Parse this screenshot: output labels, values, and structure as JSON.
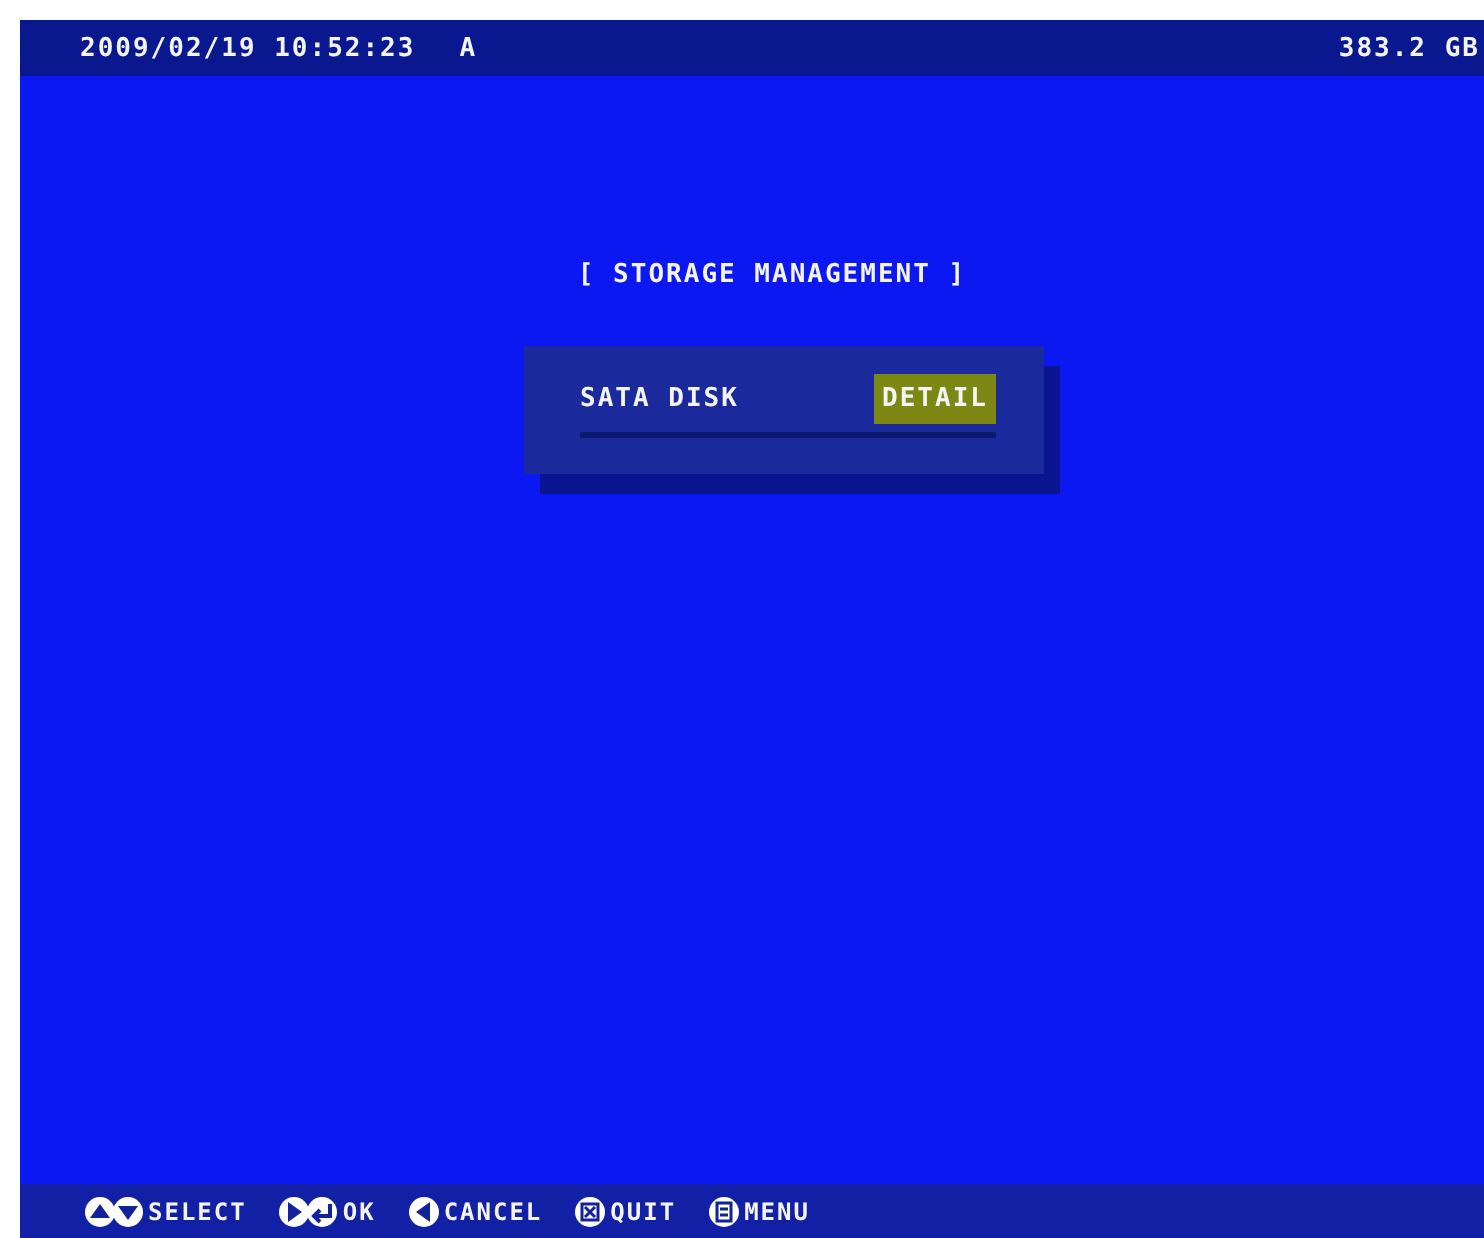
{
  "status_bar": {
    "datetime": "2009/02/19 10:52:23",
    "channel": "A",
    "capacity": "383.2 GB"
  },
  "title": "[ STORAGE MANAGEMENT ]",
  "items": [
    {
      "label": "SATA DISK",
      "button": "DETAIL",
      "selected": true
    }
  ],
  "hints": [
    {
      "kind": "updown",
      "label": "SELECT"
    },
    {
      "kind": "enter",
      "label": "OK"
    },
    {
      "kind": "left",
      "label": "CANCEL"
    },
    {
      "kind": "quit",
      "label": "QUIT"
    },
    {
      "kind": "menu",
      "label": "MENU"
    }
  ]
}
